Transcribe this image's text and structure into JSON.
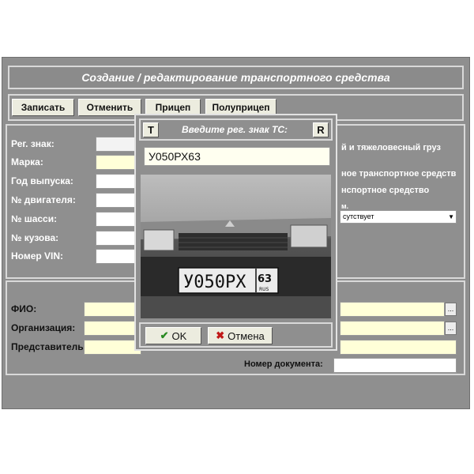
{
  "window": {
    "title": "Создание / редактирование транспортного средства"
  },
  "toolbar": {
    "buttons": [
      "Записать",
      "Отменить",
      "Прицеп",
      "Полуприцеп"
    ]
  },
  "vehicle": {
    "labels": [
      "Рег. знак:",
      "Марка:",
      "Год выпуска:",
      "№ двигателя:",
      "№ шасси:",
      "№ кузова:",
      "Номер VIN:"
    ]
  },
  "right_panel": {
    "line1": "й и тяжеловесный груз",
    "line2": "ное транспортное средств",
    "line3": "нспортное средство",
    "small_label": "м.",
    "select_value": "сутствует"
  },
  "owner": {
    "labels": [
      "ФИО:",
      "Организация:",
      "Представитель:"
    ],
    "doc_number_label": "Номер документа:",
    "ellipsis": "..."
  },
  "dialog": {
    "left_btn": "T",
    "title": "Введите рег. знак ТС:",
    "right_btn": "R",
    "plate_value": "У050РХ63",
    "photo_plate": {
      "main": "У050РХ",
      "region": "63",
      "country": "RUS"
    },
    "ok_label": "OK",
    "cancel_label": "Отмена"
  },
  "colors": {
    "window_bg": "#8f8f8f",
    "field_yellow": "#ffffd8",
    "ok_green": "#2a8a22",
    "cancel_red": "#c01818"
  }
}
